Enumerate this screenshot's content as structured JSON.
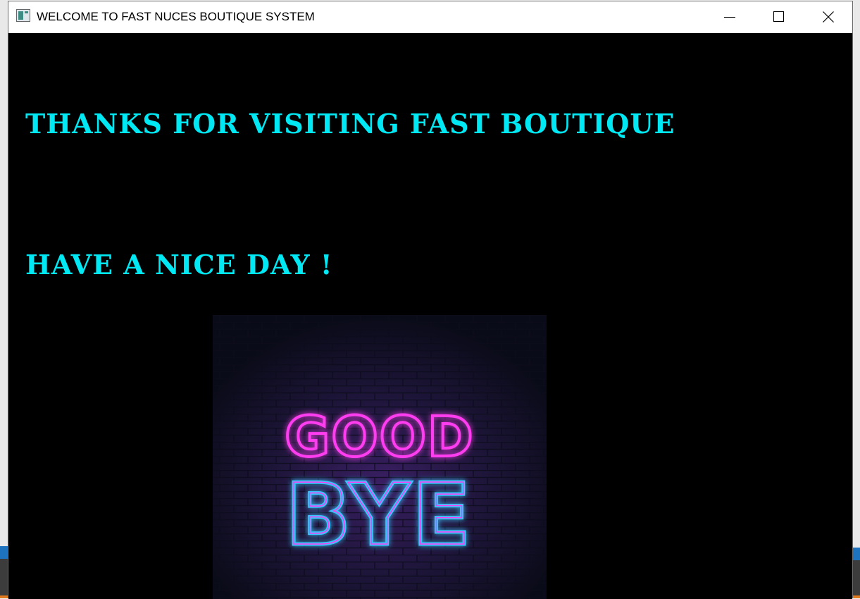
{
  "window": {
    "title": "WELCOME TO FAST NUCES BOUTIQUE SYSTEM",
    "controls": {
      "minimize": "minimize-icon",
      "maximize": "maximize-icon",
      "close": "close-icon"
    }
  },
  "main": {
    "headline_1": "THANKS FOR VISITING FAST BOUTIQUE",
    "headline_2": "HAVE A NICE DAY !",
    "image": {
      "line_1": "GOOD",
      "line_2": "BYE"
    }
  },
  "colors": {
    "headline": "#00e8f4",
    "background": "#000000",
    "neon_pink": "#ff3cf0",
    "neon_blue": "#35c8ff"
  }
}
